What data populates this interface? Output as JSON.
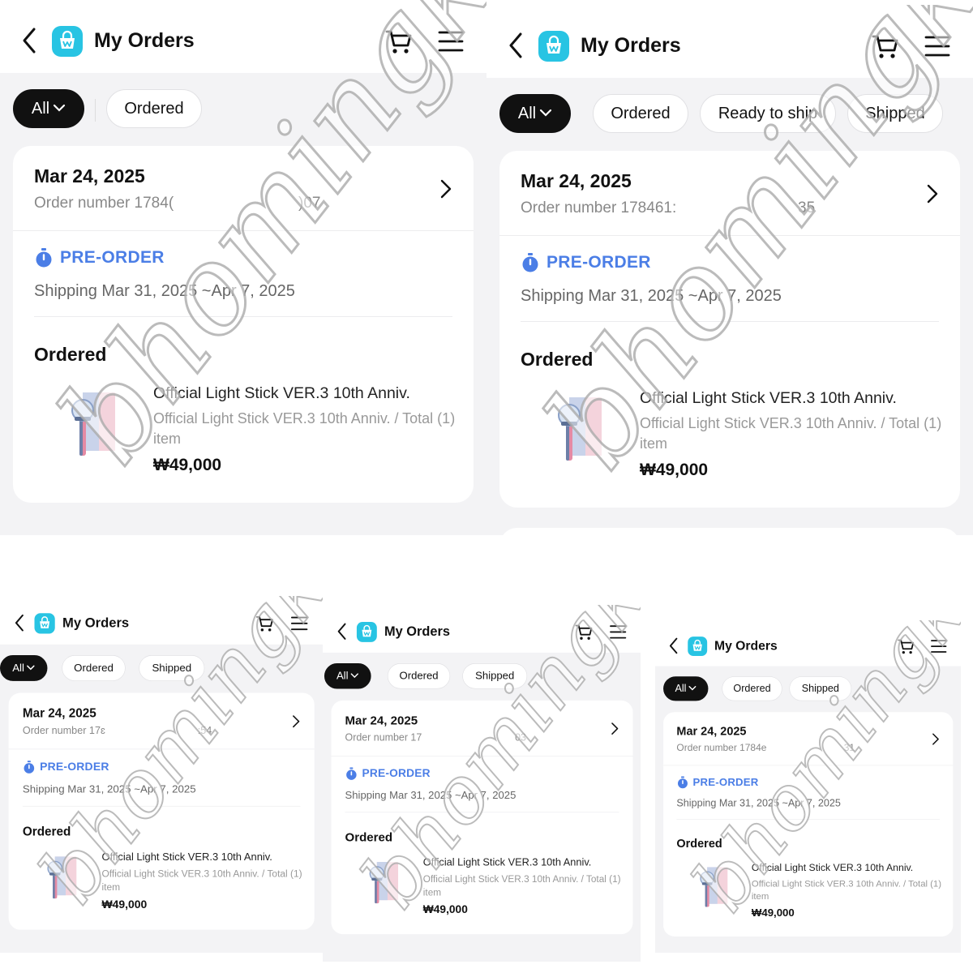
{
  "app": {
    "title": "My Orders"
  },
  "filters": {
    "all": "All",
    "ordered": "Ordered",
    "ready_to_ship": "Ready to ship",
    "shipped": "Shipped"
  },
  "order": {
    "date": "Mar 24, 2025",
    "order_number_label": "Order number",
    "preorder_label": "PRE-ORDER",
    "shipping": "Shipping Mar 31, 2025 ~Apr 7, 2025",
    "status": "Ordered",
    "product_name": "Official Light Stick VER.3 10th Anniv.",
    "product_option": "Official Light Stick VER.3 10th Anniv. / Total (1) item",
    "price": "₩49,000"
  },
  "screens": [
    {
      "number_prefix": "Order number 1784(",
      "number_suffix": ")07"
    },
    {
      "number_prefix": "Order number 178461:",
      "number_suffix": "35"
    },
    {
      "number_prefix": "Order number 17ɛ",
      "number_suffix": ":54"
    },
    {
      "number_prefix": "Order number 17",
      "number_suffix": "03"
    },
    {
      "number_prefix": "Order number 1784e",
      "number_suffix": "31"
    }
  ],
  "watermark": {
    "text": "bhomingkr"
  },
  "colors": {
    "accent_blue": "#4b7ee6",
    "logo_cyan": "#28c4e3",
    "chip_active": "#111111"
  }
}
